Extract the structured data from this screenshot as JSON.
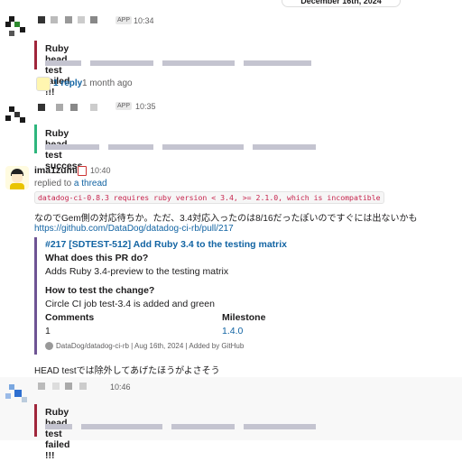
{
  "date_divider": "December 16th, 2024",
  "messages": [
    {
      "app_badge": "APP",
      "time": "10:34",
      "attachment_title": "Ruby head test failed !!!",
      "thread": {
        "replies": "1 reply",
        "ago": "1 month ago"
      }
    },
    {
      "app_badge": "APP",
      "time": "10:35",
      "attachment_title": "Ruby head test success"
    },
    {
      "author": "ima1zumi",
      "time": "10:40",
      "replied_to_prefix": "replied to ",
      "replied_to_link": "a thread",
      "code": "datadog-ci-0.8.3 requires ruby version < 3.4, >= 2.1.0, which is incompatible",
      "text": "なのでGem側の対応待ちか。ただ、3.4対応入ったのは8/16だったぽいのですぐには出ないかも",
      "url": "https://github.com/DataDog/datadog-ci-rb/pull/217",
      "unfurl": {
        "title": "#217 [SDTEST-512] Add Ruby 3.4 to the testing matrix",
        "section1_heading": "What does this PR do?",
        "section1_text": "Adds Ruby 3.4-preview to the testing matrix",
        "section2_heading": "How to test the change?",
        "section2_text": "Circle CI job test-3.4 is added and green",
        "fields": [
          {
            "label": "Comments",
            "value": "1"
          },
          {
            "label": "Milestone",
            "value": "1.4.0"
          }
        ],
        "footer_repo": "DataDog/datadog-ci-rb",
        "footer_date": "Aug 16th, 2024",
        "footer_added": "Added by GitHub"
      },
      "followup": "HEAD testでは除外してあげたほうがよさそう"
    },
    {
      "time": "10:46",
      "attachment_title": "Ruby head test failed !!!"
    }
  ],
  "colors": {
    "failed": "#a0263b",
    "success": "#2eb67d",
    "link": "#1264a3",
    "pr_border": "#6e5494"
  }
}
